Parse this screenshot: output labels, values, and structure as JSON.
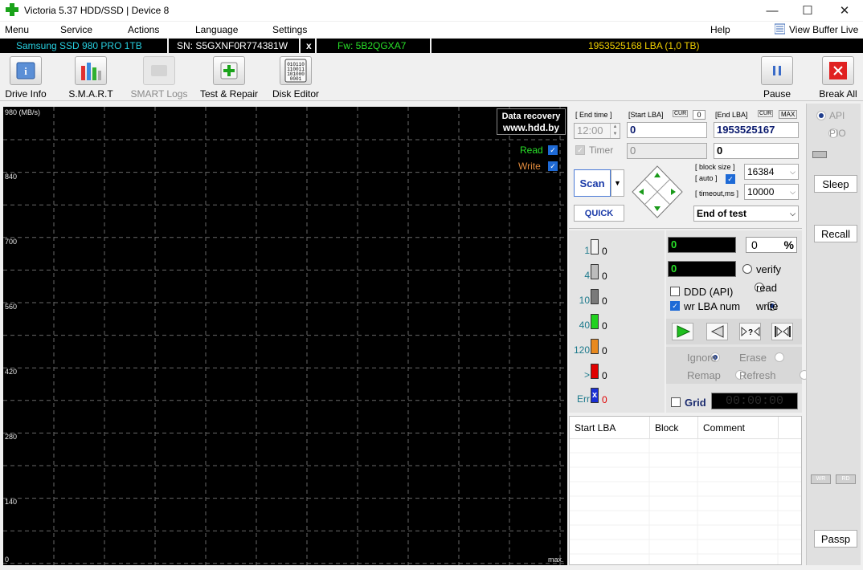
{
  "window": {
    "title": "Victoria 5.37 HDD/SSD | Device 8",
    "minimize": "—",
    "maximize": "☐",
    "close": "✕"
  },
  "menu": {
    "items": [
      "Menu",
      "Service",
      "Actions",
      "Language",
      "Settings"
    ],
    "help": "Help",
    "view_buffer": "View Buffer Live"
  },
  "infobar": {
    "model": "Samsung SSD 980 PRO 1TB",
    "serial": "SN: S5GXNF0R774381W",
    "x_label": "x",
    "firmware": "Fw: 5B2QGXA7",
    "capacity": "1953525168 LBA (1,0 TB)",
    "colors": {
      "model": "#27d0e0",
      "firmware": "#28e028",
      "capacity": "#f0d000"
    }
  },
  "toolbar": {
    "buttons": [
      {
        "label": "Drive Info",
        "icon": "drive-info-icon"
      },
      {
        "label": "S.M.A.R.T",
        "icon": "smart-icon"
      },
      {
        "label": "SMART Logs",
        "icon": "smart-logs-icon"
      },
      {
        "label": "Test & Repair",
        "icon": "test-repair-icon"
      },
      {
        "label": "Disk Editor",
        "icon": "disk-editor-icon"
      }
    ],
    "pause": "Pause",
    "break_all": "Break All"
  },
  "graph": {
    "unit_label": "980 (MB/s)",
    "y_ticks": [
      "840",
      "700",
      "560",
      "420",
      "280",
      "140",
      "0"
    ],
    "max_label": "max.",
    "watermark_line1": "Data recovery",
    "watermark_line2": "www.hdd.by",
    "legend": {
      "read": "Read",
      "write": "Write",
      "read_color": "#28e028",
      "write_color": "#e08a3c"
    }
  },
  "scan": {
    "end_time_label": "[ End time ]",
    "end_time_value": "12:00",
    "start_lba_label": "[Start LBA]",
    "cur_label": "CUR",
    "start_cur_value": "0",
    "start_lba_value": "0",
    "end_lba_label": "[End LBA]",
    "max_label": "MAX",
    "end_lba_value": "1953525167",
    "timer_label": "Timer",
    "timer_value": "0",
    "timer_right_value": "0",
    "scan_button": "Scan",
    "quick_button": "QUICK",
    "block_size_label": "[ block size ]",
    "auto_label": "[ auto ]",
    "block_size_value": "16384",
    "timeout_label": "[ timeout,ms ]",
    "timeout_value": "10000",
    "end_of_test": "End of test"
  },
  "stats": {
    "rows": [
      {
        "label": "1",
        "count": "0",
        "color": "#f4f4f4"
      },
      {
        "label": "4",
        "count": "0",
        "color": "#bcbcbc"
      },
      {
        "label": "10",
        "count": "0",
        "color": "#7a7a7a"
      },
      {
        "label": "40",
        "count": "0",
        "color": "#21d21f"
      },
      {
        "label": "120",
        "count": "0",
        "color": "#e8891f"
      },
      {
        "label": ">",
        "count": "0",
        "color": "#e00000"
      },
      {
        "label": "Err",
        "count": "0",
        "color": "#1a2fd6"
      }
    ],
    "lcd_top": "0",
    "percent_value": "0",
    "percent_sign": "%",
    "lcd_second": "0",
    "verify": "verify",
    "read": "read",
    "write": "write",
    "ddd_api": "DDD (API)",
    "wr_lba_num": "wr LBA num",
    "ignore": "Ignore",
    "erase": "Erase",
    "remap": "Remap",
    "refresh": "Refresh",
    "grid": "Grid",
    "grid_time": "00:00:00"
  },
  "log_table": {
    "columns": [
      "Start LBA",
      "Block",
      "Comment"
    ]
  },
  "right_panel": {
    "api": "API",
    "pio": "PIO",
    "sleep": "Sleep",
    "recall": "Recall",
    "wr": "WR",
    "rd": "RD",
    "passp": "Passp"
  }
}
